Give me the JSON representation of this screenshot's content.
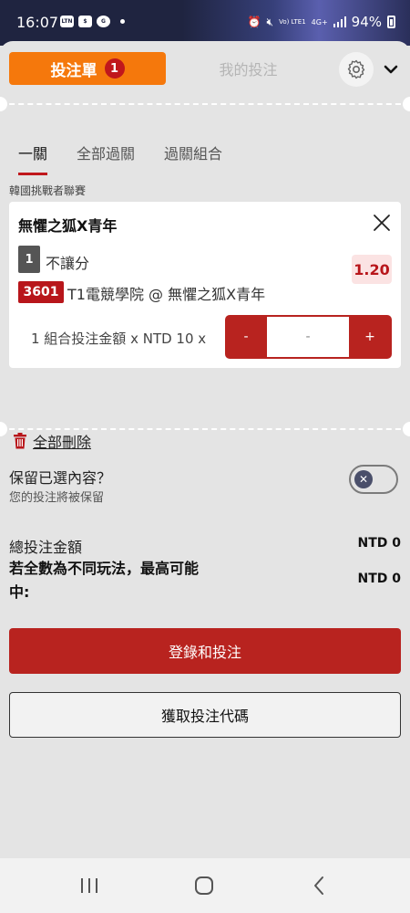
{
  "status_bar": {
    "time": "16:07",
    "mini_icons": [
      "LTN",
      "$",
      "G"
    ],
    "signal_text": "Vo) LTE1",
    "network": "4G+",
    "battery": "94%"
  },
  "header": {
    "tab_active_label": "投注單",
    "tab_active_count": "1",
    "tab_inactive_label": "我的投注"
  },
  "subtabs": [
    "一關",
    "全部過關",
    "過關組合"
  ],
  "bet": {
    "league": "韓國挑戰者聯賽",
    "match": "無懼之狐X青年",
    "market_number": "1",
    "market_name": "不讓分",
    "odds": "1.20",
    "selection_code": "3601",
    "selection": "T1電競學院 @ 無懼之狐X青年",
    "stake_label": "1 組合投注金額 x NTD 10 x",
    "stepper_minus": "-",
    "stepper_value": "-",
    "stepper_plus": "+"
  },
  "delete_all_label": "全部刪除",
  "keep": {
    "title": "保留已選內容？",
    "subtitle": "您的投注將被保留",
    "toggle_on": false
  },
  "summary": {
    "total_label": "總投注金額",
    "total_value": "NTD 0",
    "win_label": "若全數為不同玩法，最高可能中:",
    "win_value": "NTD 0"
  },
  "buttons": {
    "login": "登錄和投注",
    "get_code": "獲取投注代碼"
  },
  "colors": {
    "accent_orange": "#f5780c",
    "brand_red": "#b8231f",
    "background": "#e4e4e4"
  }
}
